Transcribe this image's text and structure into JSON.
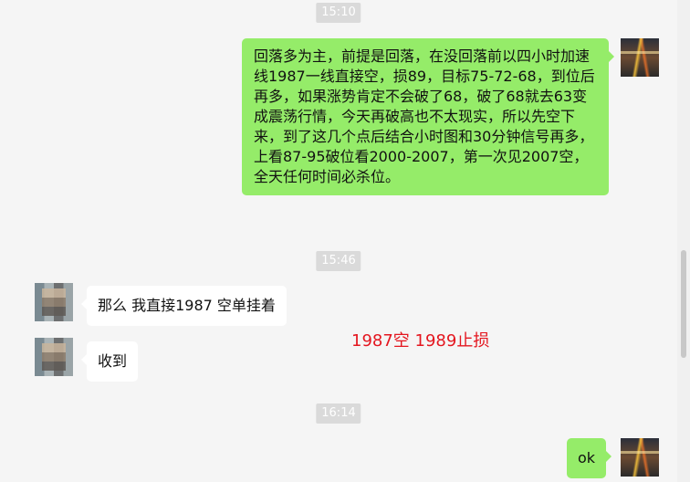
{
  "messages": {
    "ts1": "15:10",
    "msg1": "回落多为主，前提是回落，在没回落前以四小时加速线1987一线直接空，损89，目标75-72-68，到位后再多，如果涨势肯定不会破了68，破了68就去63变成震荡行情，今天再破高也不太现实，所以先空下来，到了这几个点后结合小时图和30分钟信号再多，上看87-95破位看2000-2007，第一次见2007空，全天任何时间必杀位。",
    "ts2": "15:46",
    "msg2": "那么 我直接1987 空单挂着",
    "msg3": "收到",
    "ts3": "16:14",
    "msg4": "ok"
  },
  "annotation": "1987空 1989止损",
  "colors": {
    "self_bubble": "#95ec69",
    "other_bubble": "#ffffff",
    "annotation": "#e4161f",
    "timestamp_bg": "#dadada"
  }
}
